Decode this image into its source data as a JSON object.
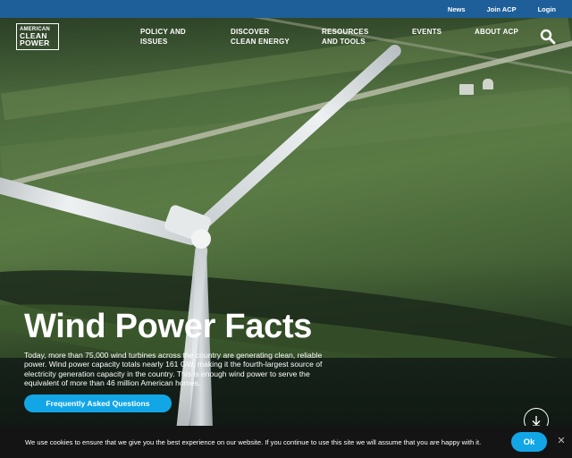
{
  "topbar": {
    "links": [
      "News",
      "Join ACP",
      "Login"
    ]
  },
  "logo": {
    "line1": "AMERICAN",
    "line2": "CLEAN",
    "line3": "POWER"
  },
  "nav": {
    "items": [
      {
        "line1": "POLICY AND",
        "line2": "ISSUES"
      },
      {
        "line1": "DISCOVER",
        "line2": "CLEAN ENERGY"
      },
      {
        "line1": "RESOURCES",
        "line2": "AND TOOLS"
      },
      {
        "line1": "EVENTS",
        "line2": ""
      },
      {
        "line1": "ABOUT ACP",
        "line2": ""
      }
    ],
    "search_icon": "search-icon"
  },
  "hero": {
    "title": "Wind Power Facts",
    "description": "Today, more than 75,000 wind turbines across the country are generating clean, reliable power. Wind power capacity totals nearly 161 GW, making it the fourth-largest source of electricity generation capacity in the country. This is enough wind power to serve the equivalent of more than 46 million American homes.",
    "cta_label": "Frequently Asked Questions",
    "scroll_icon": "arrow-down-circle-icon"
  },
  "cookie": {
    "text": "We use cookies to ensure that we give you the best experience on our website. If you continue to use this site we will assume that you are happy with it.",
    "ok_label": "Ok",
    "close_icon": "close-icon"
  },
  "colors": {
    "topbar": "#1e5f99",
    "accent": "#12a6e6",
    "cookie_bg": "#141414"
  }
}
